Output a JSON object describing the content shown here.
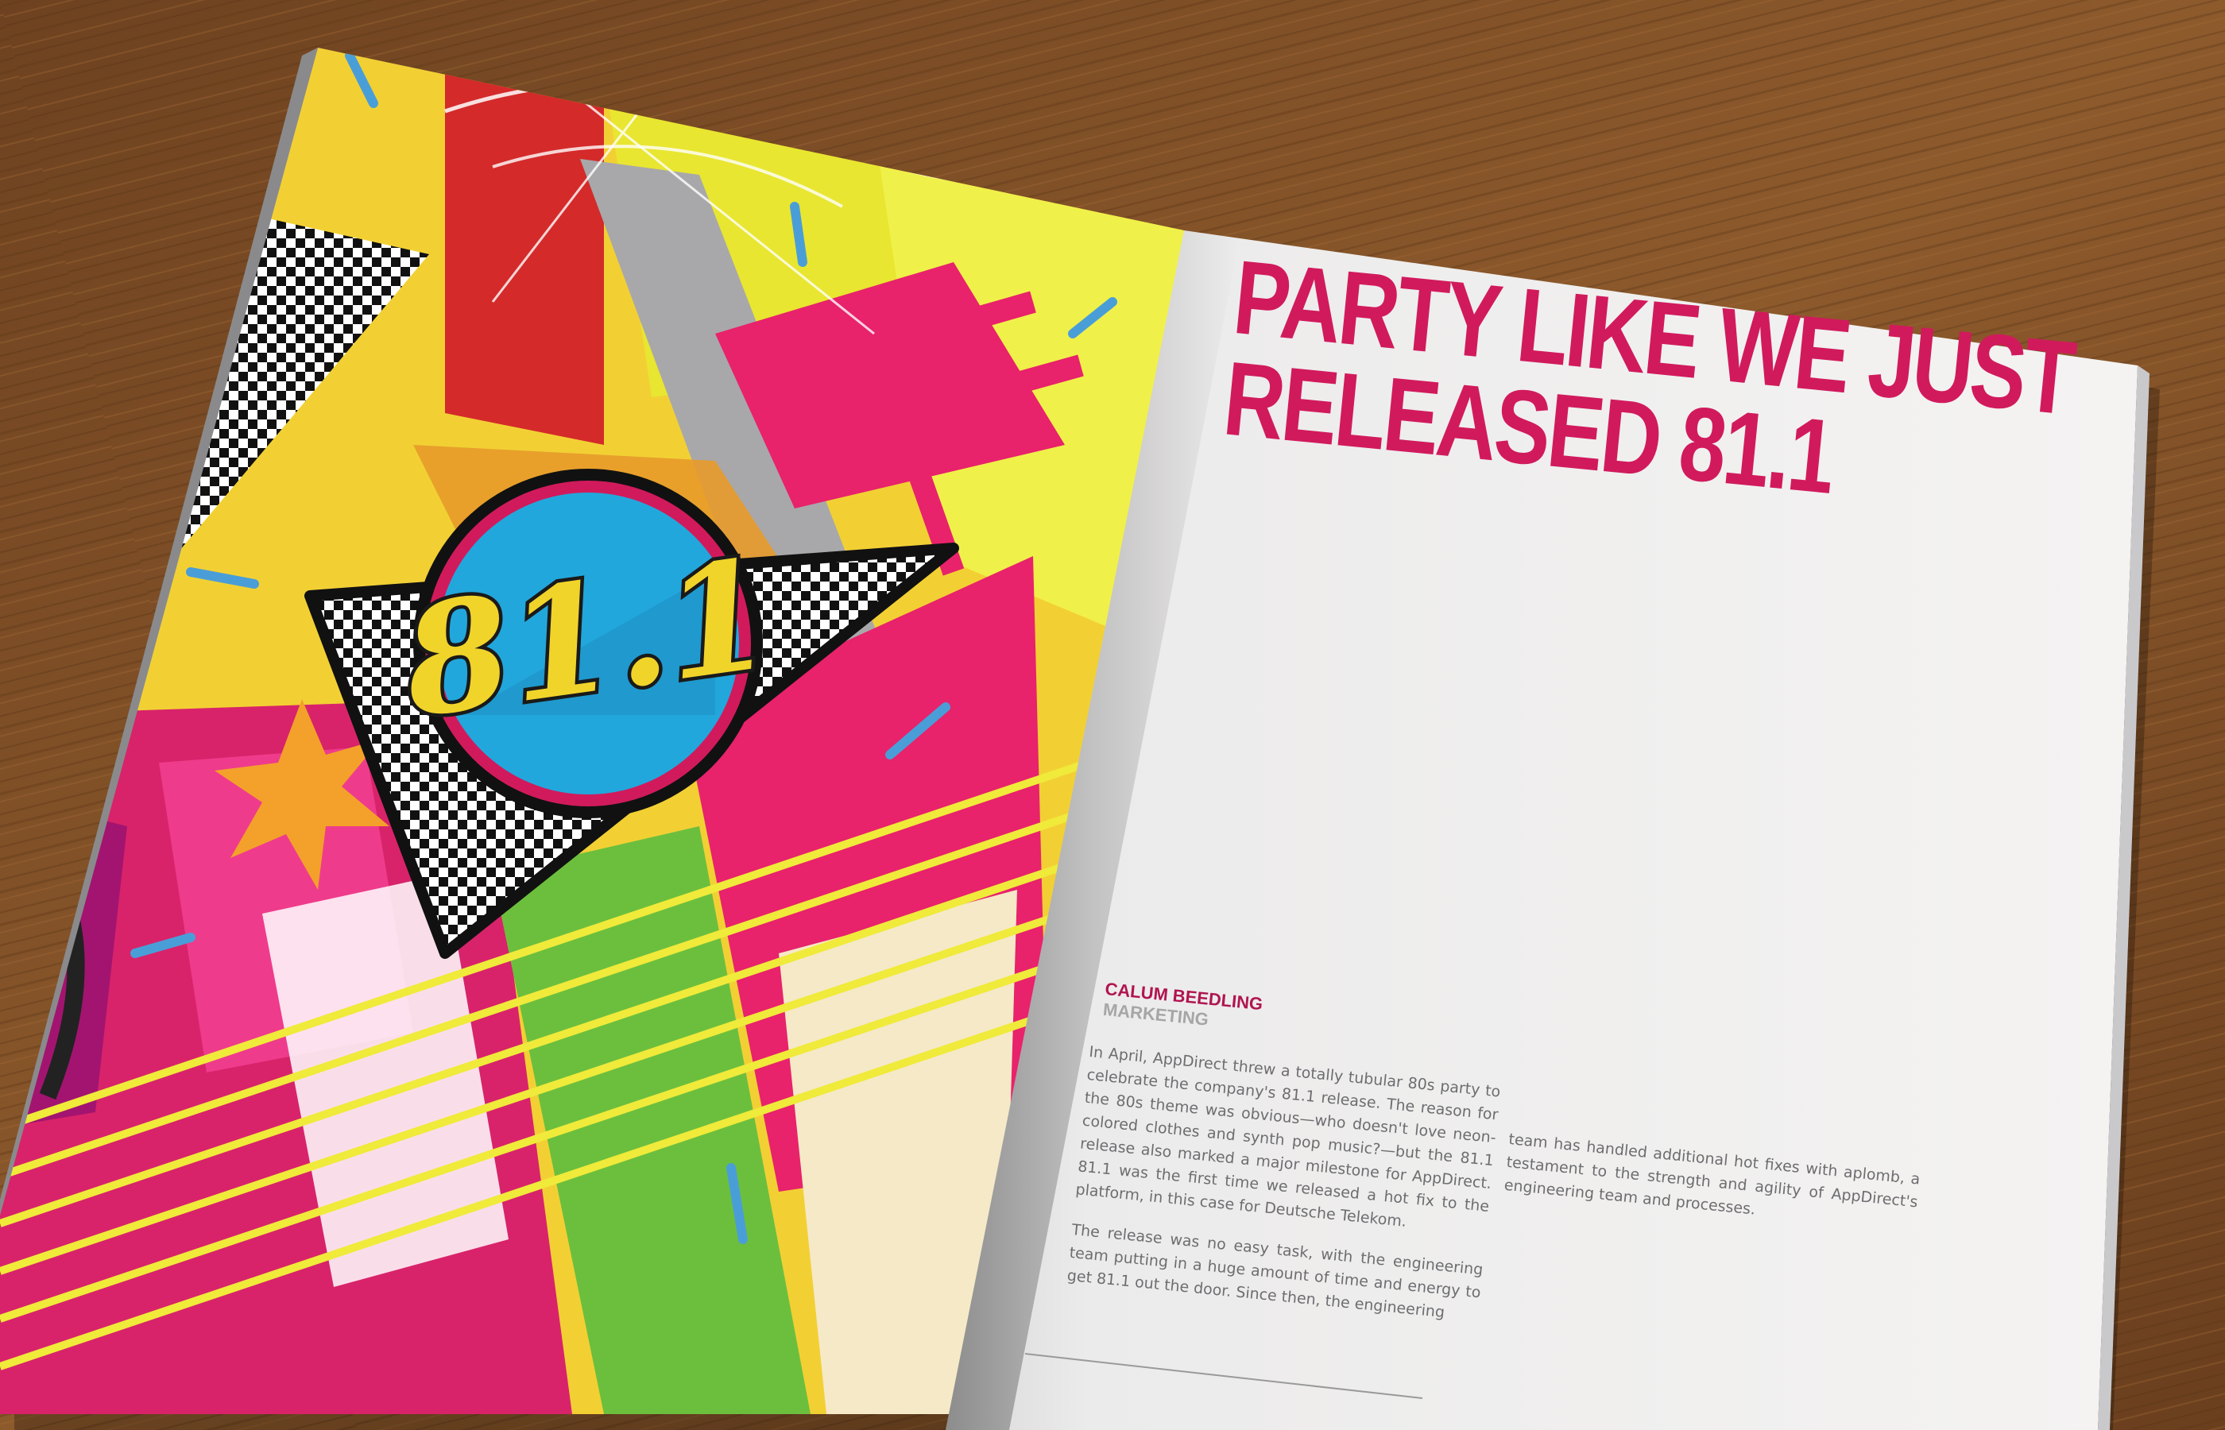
{
  "colors": {
    "magenta": "#e8226b",
    "pink": "#d11a5c",
    "yellow": "#e8e630",
    "cyan": "#22a7dc",
    "green": "#6cbf3d",
    "wood": "#8b5a2b",
    "paper": "#f2f1f0"
  },
  "left_page": {
    "badge_text": "81.1"
  },
  "right_page": {
    "headline_line1": "PARTY LIKE WE JUST",
    "headline_line2": "RELEASED 81.1",
    "author": "CALUM BEEDLING",
    "role": "MARKETING",
    "paragraph1": "In April, AppDirect threw a totally tubular 80s party to celebrate the company's 81.1 release. The reason for the 80s theme was obvious—who doesn't love neon-colored clothes and synth pop music?—but the 81.1 release also marked a major milestone for AppDirect. 81.1 was the first time we released a hot fix to the platform, in this case for Deutsche Telekom.",
    "paragraph2": "The release was no easy task, with the engineering team putting in a huge amount of time and energy to get 81.1 out the door. Since then, the engineering",
    "paragraph3": "team has handled additional hot fixes with aplomb, a testament to the strength and agility of AppDirect's engineering team and processes."
  }
}
